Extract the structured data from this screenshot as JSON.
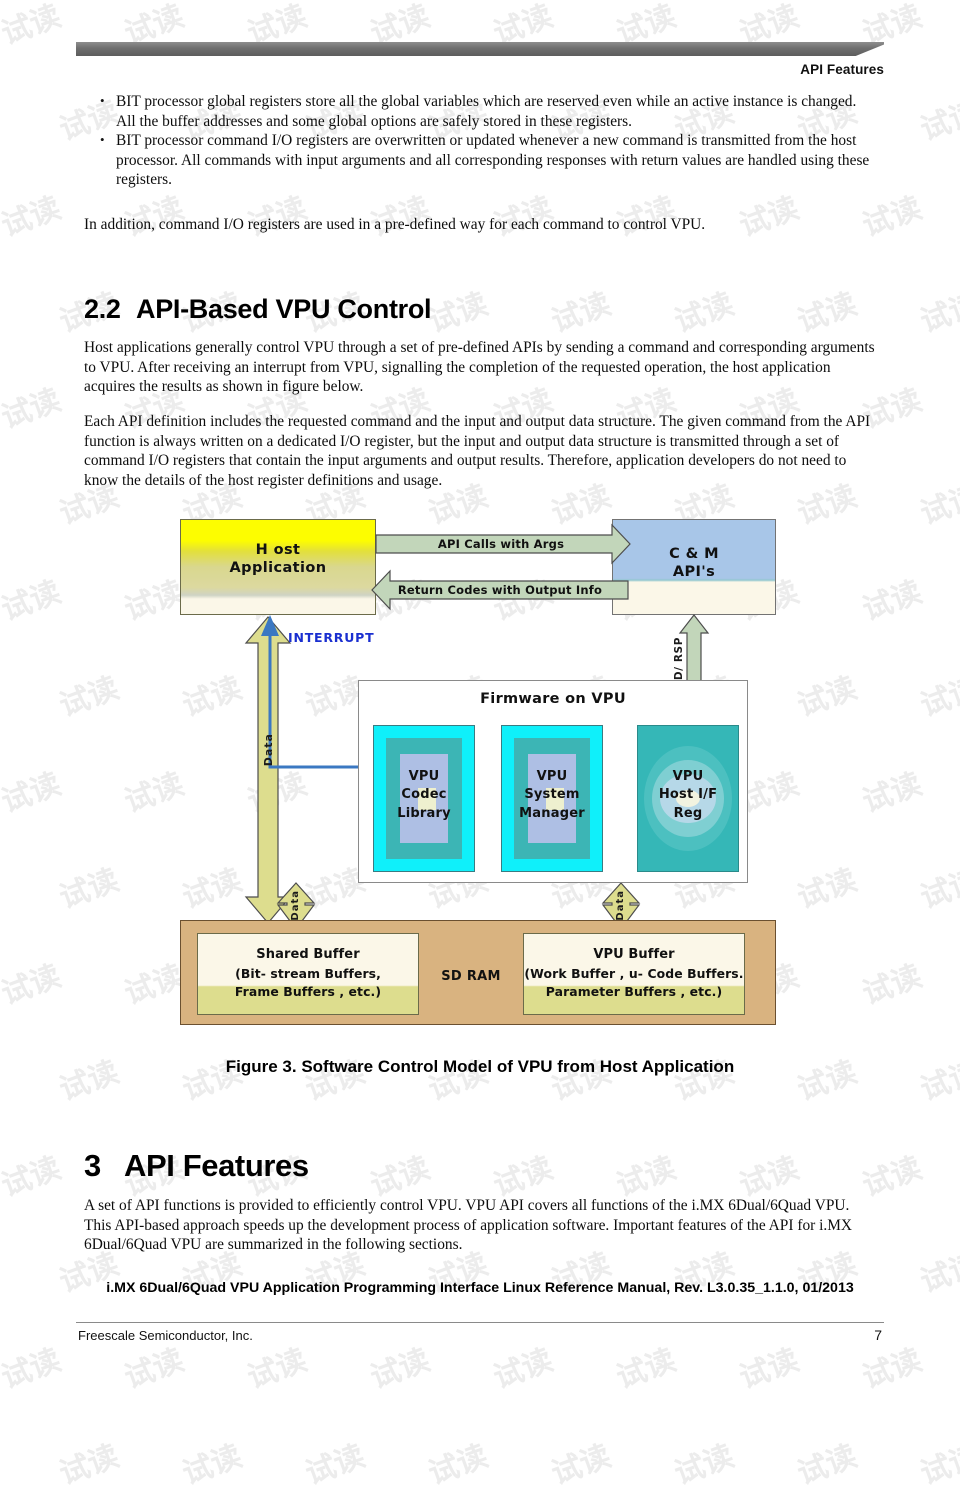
{
  "header": {
    "title": "API Features"
  },
  "body": {
    "bullets": [
      "BIT processor global registers store all the global variables which are reserved even while an active instance is changed. All the buffer addresses and some global options are safely stored in these registers.",
      "BIT processor command I/O registers are overwritten or updated whenever a new command is transmitted from the host processor. All commands with input arguments and all corresponding responses with return values are handled using these registers."
    ],
    "intro_para": "In addition, command I/O registers are used in a pre-defined way for each command to control VPU.",
    "section22": {
      "number": "2.2",
      "title": "API-Based VPU Control"
    },
    "para1": "Host applications generally control VPU through a set of pre-defined APIs by sending a command and corresponding arguments to VPU. After receiving an interrupt from VPU, signalling the completion of the requested operation, the host application acquires the results as shown in figure below.",
    "para2": "Each API definition includes the requested command and the input and output data structure. The given command from the API function is always written on a dedicated I/O register, but the input and output data structure is transmitted through a set of command I/O registers that contain the input arguments and output results. Therefore, application developers do not need to know the details of the host register definitions and usage.",
    "figure_caption": "Figure 3. Software Control Model of VPU from Host Application",
    "section3": {
      "number": "3",
      "title": "API Features"
    },
    "para3": "A set of API functions is provided to efficiently control VPU. VPU API covers all functions of the i.MX 6Dual/6Quad VPU. This API-based approach speeds up the development process of application software. Important features of the API for i.MX 6Dual/6Quad VPU are summarized in the following sections."
  },
  "figure": {
    "host_application": "Host\nApplication",
    "host_application_line1": "H ost",
    "host_application_line2": "Application",
    "cm_apis_line1": "C & M",
    "cm_apis_line2": "API's",
    "arrow_api_calls": "API Calls with Args",
    "arrow_return_codes": "Return Codes with Output Info",
    "interrupt": "INTERRUPT",
    "cmd_rsp": "CMD/ RSP",
    "data_label": "Data",
    "firmware_title": "Firmware on VPU",
    "modules": [
      {
        "line1": "VPU",
        "line2": "Codec",
        "line3": "Library"
      },
      {
        "line1": "VPU",
        "line2": "System",
        "line3": "Manager"
      },
      {
        "line1": "VPU",
        "line2": "Host I/F",
        "line3": "Reg"
      }
    ],
    "sdram": "SD RAM",
    "shared_buffer": {
      "title": "Shared Buffer",
      "line2": "(Bit- stream Buffers,",
      "line3": "Frame Buffers , etc.)"
    },
    "vpu_buffer": {
      "title": "VPU Buffer",
      "line2": "(Work Buffer , u- Code Buffers.",
      "line3": "Parameter Buffers , etc.)"
    }
  },
  "footer": {
    "title": "i.MX 6Dual/6Quad VPU Application Programming Interface Linux Reference Manual, Rev. L3.0.35_1.1.0, 01/2013",
    "company": "Freescale Semiconductor, Inc.",
    "page_number": "7"
  },
  "watermark": {
    "text": "试读"
  },
  "colors": {
    "header_bar": "#6e6e6e",
    "host_box": "#fdfd00",
    "cm_box": "#a8c6e8",
    "arrow_green": "#c2d6ba",
    "arrow_yellow": "#dddd8e",
    "module_cyan": "#0ff0fa",
    "module_teal": "#35b7b7",
    "sdram_tan": "#d9b380",
    "interrupt_blue": "#1a2fd0"
  }
}
